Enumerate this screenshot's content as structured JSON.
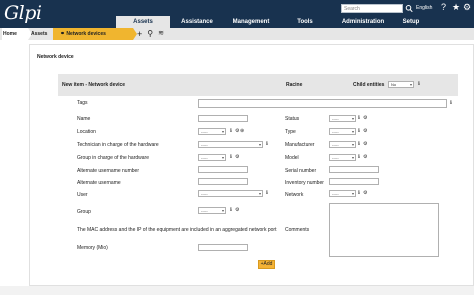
{
  "app": {
    "logo": "Glpi"
  },
  "search": {
    "placeholder": "Search"
  },
  "header": {
    "language": "English",
    "help_icon": "question-icon",
    "fav_icon": "star-icon",
    "prefs_icon": "gear-icon"
  },
  "menu": [
    {
      "label": "Assets",
      "active": true
    },
    {
      "label": "Assistance"
    },
    {
      "label": "Management"
    },
    {
      "label": "Tools"
    },
    {
      "label": "Administration"
    },
    {
      "label": "Setup"
    }
  ],
  "breadcrumb": {
    "home": "Home",
    "assets": "Assets",
    "current": "Network devices"
  },
  "toolbar_icons": [
    "plus-icon",
    "search-icon",
    "layers-icon"
  ],
  "section": {
    "title": "Network device"
  },
  "form": {
    "title": "New item - Network device",
    "entity": "Racine",
    "child_entities_label": "Child entities",
    "child_entities_value": "No",
    "labels": {
      "tags": "Tags",
      "name": "Name",
      "status": "Status",
      "location": "Location",
      "type": "Type",
      "tech": "Technician in charge of the hardware",
      "manufacturer": "Manufacturer",
      "group_tech": "Group in charge of the hardware",
      "model": "Model",
      "alt_user_number": "Alternate username number",
      "serial": "Serial number",
      "alt_user": "Alternate username",
      "inventory": "Inventory number",
      "user": "User",
      "network": "Network",
      "group": "Group",
      "comments": "Comments",
      "mac_ip": "The MAC address and the IP of the equipment are included in an aggregated network port",
      "memory": "Memory (Mio)"
    },
    "select_placeholder": "-----",
    "add_button": "+Add"
  },
  "colors": {
    "topbar": "#18324f",
    "active_tab": "#e6e6e6",
    "accent": "#f0b52f"
  }
}
